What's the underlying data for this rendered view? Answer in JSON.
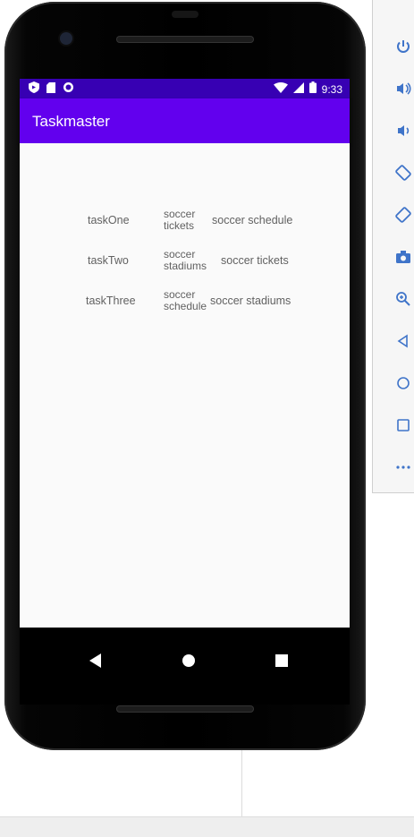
{
  "status_bar": {
    "time": "9:33"
  },
  "app_bar": {
    "title": "Taskmaster"
  },
  "tasks": [
    {
      "name": "taskOne",
      "body": "soccer tickets",
      "state": "soccer schedule"
    },
    {
      "name": "taskTwo",
      "body": "soccer stadiums",
      "state": "soccer tickets"
    },
    {
      "name": "taskThree",
      "body": "soccer schedule",
      "state": "soccer stadiums"
    }
  ],
  "emulator_toolbar": {
    "buttons": [
      "power-icon",
      "volume-up-icon",
      "volume-down-icon",
      "rotate-left-icon",
      "rotate-right-icon",
      "screenshot-icon",
      "zoom-icon",
      "back-icon",
      "home-icon",
      "overview-icon",
      "more-icon"
    ]
  },
  "colors": {
    "status_bar": "#3700b3",
    "app_bar": "#6200ee",
    "content_bg": "#fafafa",
    "icon_blue": "#3f74c9"
  }
}
